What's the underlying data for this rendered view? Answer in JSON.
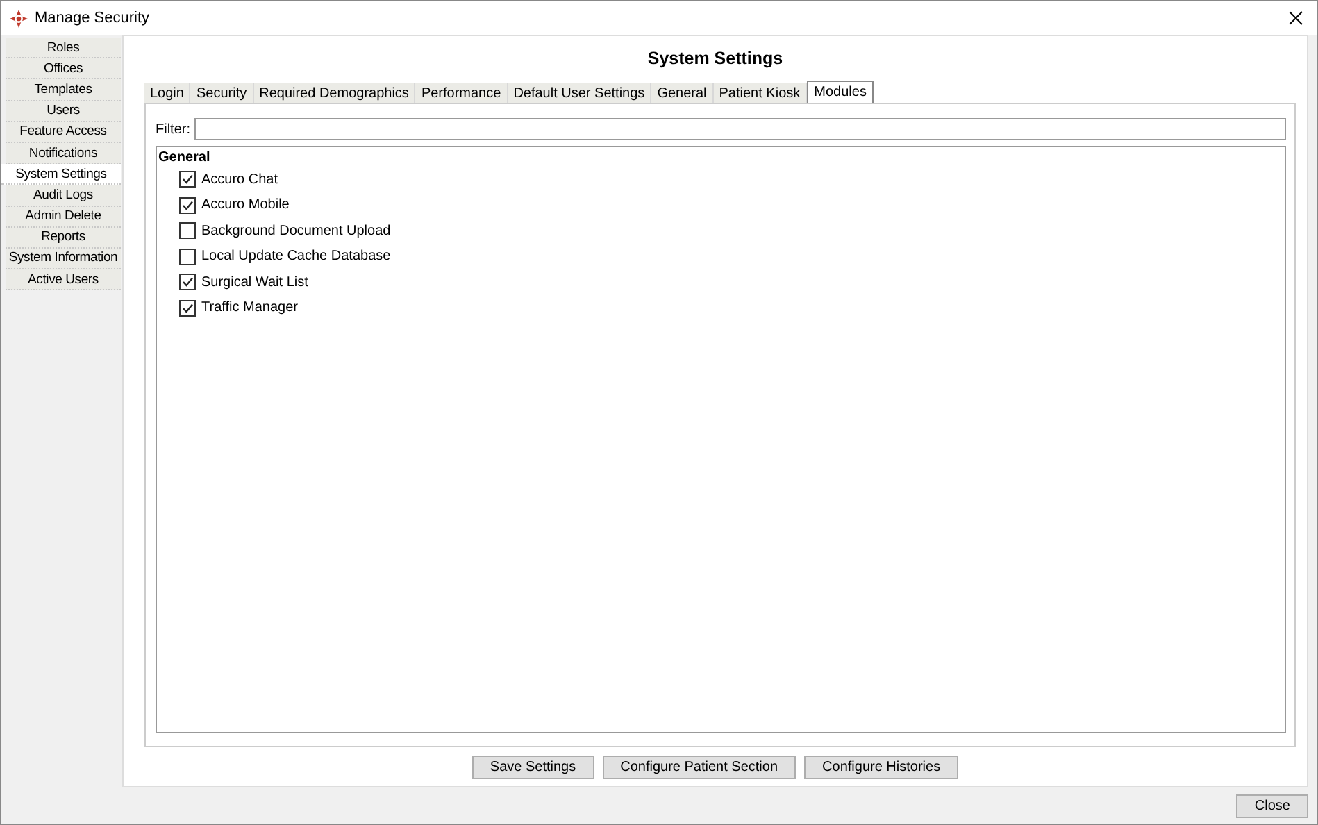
{
  "window": {
    "title": "Manage Security"
  },
  "sidebar": {
    "items": [
      {
        "label": "Roles",
        "selected": false
      },
      {
        "label": "Offices",
        "selected": false
      },
      {
        "label": "Templates",
        "selected": false
      },
      {
        "label": "Users",
        "selected": false
      },
      {
        "label": "Feature Access",
        "selected": false
      },
      {
        "label": "Notifications",
        "selected": false
      },
      {
        "label": "System Settings",
        "selected": true
      },
      {
        "label": "Audit Logs",
        "selected": false
      },
      {
        "label": "Admin Delete",
        "selected": false
      },
      {
        "label": "Reports",
        "selected": false
      },
      {
        "label": "System Information",
        "selected": false
      },
      {
        "label": "Active Users",
        "selected": false
      }
    ]
  },
  "panel": {
    "title": "System Settings",
    "tabs": [
      {
        "label": "Login",
        "selected": false
      },
      {
        "label": "Security",
        "selected": false
      },
      {
        "label": "Required Demographics",
        "selected": false
      },
      {
        "label": "Performance",
        "selected": false
      },
      {
        "label": "Default User Settings",
        "selected": false
      },
      {
        "label": "General",
        "selected": false
      },
      {
        "label": "Patient Kiosk",
        "selected": false
      },
      {
        "label": "Modules",
        "selected": true
      }
    ],
    "filter": {
      "label": "Filter:"
    },
    "group": {
      "title": "General",
      "items": [
        {
          "label": "Accuro Chat",
          "checked": true
        },
        {
          "label": "Accuro Mobile",
          "checked": true
        },
        {
          "label": "Background Document Upload",
          "checked": false
        },
        {
          "label": "Local Update Cache Database",
          "checked": false
        },
        {
          "label": "Surgical Wait List",
          "checked": true
        },
        {
          "label": "Traffic Manager",
          "checked": true
        }
      ]
    },
    "buttons": [
      "Save Settings",
      "Configure Patient Section",
      "Configure Histories"
    ]
  },
  "footer": {
    "buttons": [
      "Close"
    ]
  }
}
